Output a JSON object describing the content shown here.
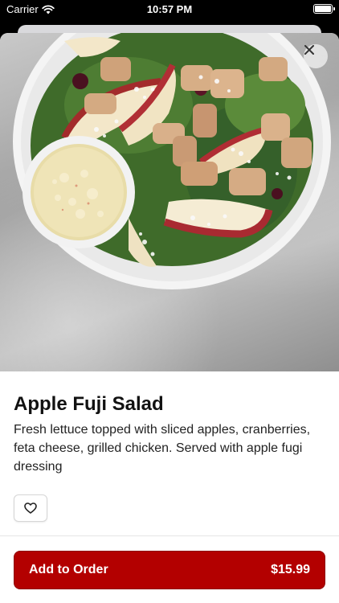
{
  "status_bar": {
    "carrier": "Carrier",
    "time": "10:57 PM"
  },
  "item": {
    "title": "Apple Fuji Salad",
    "description": "Fresh lettuce topped with sliced apples, cranberries, feta cheese, grilled chicken. Served with apple fugi dressing"
  },
  "order_button": {
    "label": "Add to Order",
    "price": "$15.99"
  },
  "colors": {
    "accent": "#b30000",
    "background": "#ffffff"
  },
  "icons": {
    "close": "close-icon",
    "favorite": "heart-icon",
    "wifi": "wifi-icon",
    "battery": "battery-icon"
  }
}
